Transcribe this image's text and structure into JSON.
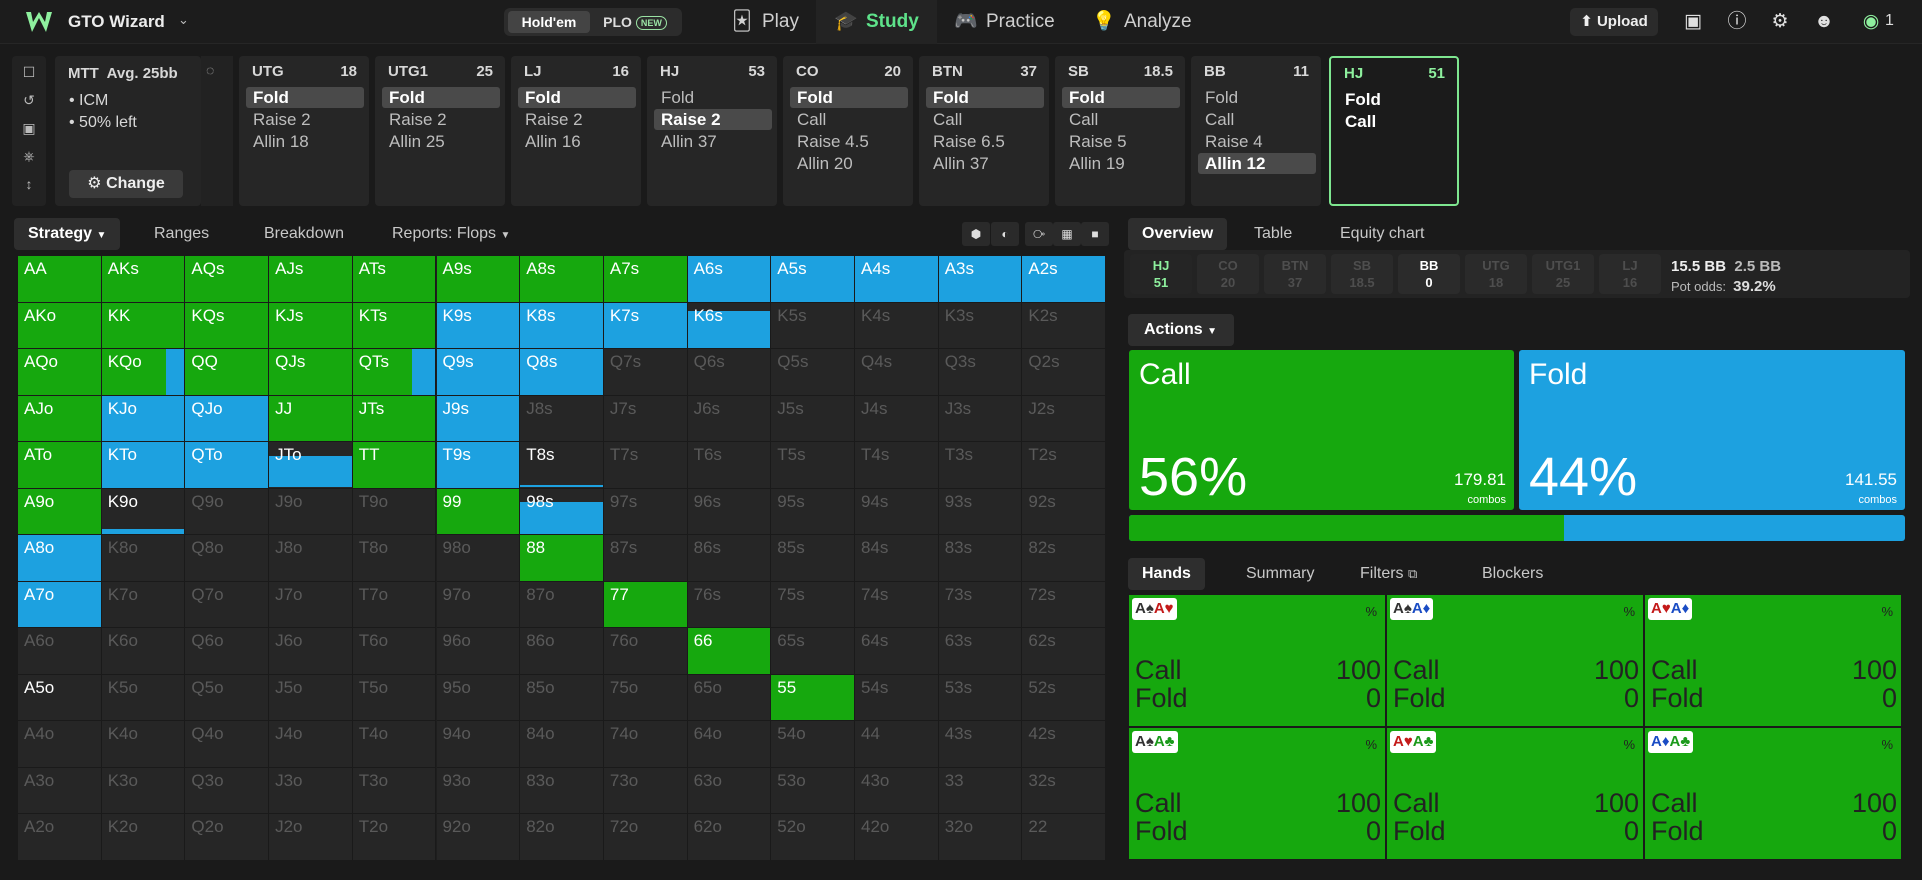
{
  "app": {
    "brand": "GTO Wizard",
    "game_tabs": {
      "holdem": "Hold'em",
      "plo": "PLO",
      "plo_badge": "NEW"
    },
    "nav": {
      "play": "Play",
      "study": "Study",
      "practice": "Practice",
      "analyze": "Analyze"
    },
    "upload": "Upload",
    "coins": "1"
  },
  "info": {
    "title": "MTT  Avg. 25bb",
    "items": [
      "ICM",
      "50% left"
    ],
    "change": "Change"
  },
  "positions": [
    {
      "name": "UTG",
      "stack": "18",
      "actions": [
        "Fold",
        "Raise 2",
        "Allin 18"
      ],
      "selected": 0
    },
    {
      "name": "UTG1",
      "stack": "25",
      "actions": [
        "Fold",
        "Raise 2",
        "Allin 25"
      ],
      "selected": 0
    },
    {
      "name": "LJ",
      "stack": "16",
      "actions": [
        "Fold",
        "Raise 2",
        "Allin 16"
      ],
      "selected": 0
    },
    {
      "name": "HJ",
      "stack": "53",
      "actions": [
        "Fold",
        "Raise 2",
        "Allin 37"
      ],
      "selected": 1
    },
    {
      "name": "CO",
      "stack": "20",
      "actions": [
        "Fold",
        "Call",
        "Raise 4.5",
        "Allin 20"
      ],
      "selected": 0
    },
    {
      "name": "BTN",
      "stack": "37",
      "actions": [
        "Fold",
        "Call",
        "Raise 6.5",
        "Allin 37"
      ],
      "selected": 0
    },
    {
      "name": "SB",
      "stack": "18.5",
      "actions": [
        "Fold",
        "Call",
        "Raise 5",
        "Allin 19"
      ],
      "selected": 0
    },
    {
      "name": "BB",
      "stack": "11",
      "actions": [
        "Fold",
        "Call",
        "Raise 4",
        "Allin 12"
      ],
      "selected": 3
    },
    {
      "name": "HJ",
      "stack": "51",
      "actions": [
        "Fold",
        "Call"
      ],
      "selected": -1,
      "active": true
    }
  ],
  "left_tabs": {
    "strategy": "Strategy",
    "ranges": "Ranges",
    "breakdown": "Breakdown",
    "reports": "Reports: Flops"
  },
  "grid": {
    "labels": [
      [
        "AA",
        "AKs",
        "AQs",
        "AJs",
        "ATs",
        "A9s",
        "A8s",
        "A7s",
        "A6s",
        "A5s",
        "A4s",
        "A3s",
        "A2s"
      ],
      [
        "AKo",
        "KK",
        "KQs",
        "KJs",
        "KTs",
        "K9s",
        "K8s",
        "K7s",
        "K6s",
        "K5s",
        "K4s",
        "K3s",
        "K2s"
      ],
      [
        "AQo",
        "KQo",
        "QQ",
        "QJs",
        "QTs",
        "Q9s",
        "Q8s",
        "Q7s",
        "Q6s",
        "Q5s",
        "Q4s",
        "Q3s",
        "Q2s"
      ],
      [
        "AJo",
        "KJo",
        "QJo",
        "JJ",
        "JTs",
        "J9s",
        "J8s",
        "J7s",
        "J6s",
        "J5s",
        "J4s",
        "J3s",
        "J2s"
      ],
      [
        "ATo",
        "KTo",
        "QTo",
        "JTo",
        "TT",
        "T9s",
        "T8s",
        "T7s",
        "T6s",
        "T5s",
        "T4s",
        "T3s",
        "T2s"
      ],
      [
        "A9o",
        "K9o",
        "Q9o",
        "J9o",
        "T9o",
        "99",
        "98s",
        "97s",
        "96s",
        "95s",
        "94s",
        "93s",
        "92s"
      ],
      [
        "A8o",
        "K8o",
        "Q8o",
        "J8o",
        "T8o",
        "98o",
        "88",
        "87s",
        "86s",
        "85s",
        "84s",
        "83s",
        "82s"
      ],
      [
        "A7o",
        "K7o",
        "Q7o",
        "J7o",
        "T7o",
        "97o",
        "87o",
        "77",
        "76s",
        "75s",
        "74s",
        "73s",
        "72s"
      ],
      [
        "A6o",
        "K6o",
        "Q6o",
        "J6o",
        "T6o",
        "96o",
        "86o",
        "76o",
        "66",
        "65s",
        "64s",
        "63s",
        "62s"
      ],
      [
        "A5o",
        "K5o",
        "Q5o",
        "J5o",
        "T5o",
        "95o",
        "85o",
        "75o",
        "65o",
        "55",
        "54s",
        "53s",
        "52s"
      ],
      [
        "A4o",
        "K4o",
        "Q4o",
        "J4o",
        "T4o",
        "94o",
        "84o",
        "74o",
        "64o",
        "54o",
        "44",
        "43s",
        "42s"
      ],
      [
        "A3o",
        "K3o",
        "Q3o",
        "J3o",
        "T3o",
        "93o",
        "83o",
        "73o",
        "63o",
        "53o",
        "43o",
        "33",
        "32s"
      ],
      [
        "A2o",
        "K2o",
        "Q2o",
        "J2o",
        "T2o",
        "92o",
        "82o",
        "72o",
        "62o",
        "52o",
        "42o",
        "32o",
        "22"
      ]
    ],
    "strategy": {
      "AA": [
        1,
        0,
        1
      ],
      "AKs": [
        1,
        0,
        1
      ],
      "AQs": [
        1,
        0,
        1
      ],
      "AJs": [
        1,
        0,
        1
      ],
      "ATs": [
        1,
        0,
        1
      ],
      "A9s": [
        1,
        0,
        1
      ],
      "A8s": [
        1,
        0,
        1
      ],
      "A7s": [
        1,
        0,
        1
      ],
      "A6s": [
        0,
        1,
        1
      ],
      "A5s": [
        0,
        1,
        1
      ],
      "A4s": [
        0,
        1,
        1
      ],
      "A3s": [
        0,
        1,
        1
      ],
      "A2s": [
        0,
        1,
        1
      ],
      "AKo": [
        1,
        0,
        1
      ],
      "KK": [
        1,
        0,
        1
      ],
      "KQs": [
        1,
        0,
        1
      ],
      "KJs": [
        1,
        0,
        1
      ],
      "KTs": [
        1,
        0,
        1
      ],
      "K9s": [
        0,
        1,
        1
      ],
      "K8s": [
        0,
        1,
        1
      ],
      "K7s": [
        0,
        1,
        1
      ],
      "K6s": [
        0,
        1,
        0.82
      ],
      "AQo": [
        1,
        0,
        1
      ],
      "KQo": [
        0.78,
        0.22,
        1
      ],
      "QQ": [
        1,
        0,
        1
      ],
      "QJs": [
        1,
        0,
        1
      ],
      "QTs": [
        0.72,
        0.28,
        1
      ],
      "Q9s": [
        0,
        1,
        1
      ],
      "Q8s": [
        0,
        1,
        1
      ],
      "AJo": [
        1,
        0,
        1
      ],
      "KJo": [
        0,
        1,
        1
      ],
      "QJo": [
        0,
        1,
        1
      ],
      "JJ": [
        1,
        0,
        1
      ],
      "JTs": [
        1,
        0,
        1
      ],
      "J9s": [
        0,
        1,
        1
      ],
      "ATo": [
        1,
        0,
        1
      ],
      "KTo": [
        0,
        1,
        1
      ],
      "QTo": [
        0,
        1,
        1
      ],
      "JTo": [
        0,
        1,
        0.7
      ],
      "TT": [
        1,
        0,
        1
      ],
      "T9s": [
        0,
        1,
        1
      ],
      "T8s": [
        0,
        1,
        0.06
      ],
      "A9o": [
        1,
        0,
        1
      ],
      "K9o": [
        0,
        1,
        0.12
      ],
      "99": [
        1,
        0,
        1
      ],
      "98s": [
        0,
        1,
        0.7
      ],
      "A8o": [
        0,
        1,
        1
      ],
      "88": [
        1,
        0,
        1
      ],
      "A7o": [
        0,
        1,
        1
      ],
      "77": [
        1,
        0,
        1
      ],
      "66": [
        1,
        0,
        1
      ],
      "A5o": [
        0,
        0,
        0
      ],
      "55": [
        1,
        0,
        1
      ]
    },
    "played": [
      "AA",
      "AKs",
      "AQs",
      "AJs",
      "ATs",
      "A9s",
      "A8s",
      "A7s",
      "A6s",
      "A5s",
      "A4s",
      "A3s",
      "A2s",
      "AKo",
      "KK",
      "KQs",
      "KJs",
      "KTs",
      "K9s",
      "K8s",
      "K7s",
      "K6s",
      "AQo",
      "KQo",
      "QQ",
      "QJs",
      "QTs",
      "Q9s",
      "Q8s",
      "AJo",
      "KJo",
      "QJo",
      "JJ",
      "JTs",
      "J9s",
      "ATo",
      "KTo",
      "QTo",
      "JTo",
      "TT",
      "T9s",
      "T8s",
      "A9o",
      "K9o",
      "99",
      "98s",
      "A8o",
      "88",
      "A7o",
      "77",
      "66",
      "A5o",
      "55"
    ]
  },
  "colors": {
    "call": "#16a80e",
    "fold": "#1da1e0",
    "empty": "#262626"
  },
  "right_tabs": {
    "overview": "Overview",
    "table": "Table",
    "equity": "Equity chart"
  },
  "seats": [
    {
      "name": "HJ",
      "stack": "51",
      "state": "hero"
    },
    {
      "name": "CO",
      "stack": "20",
      "state": "dim"
    },
    {
      "name": "BTN",
      "stack": "37",
      "state": "dim"
    },
    {
      "name": "SB",
      "stack": "18.5",
      "state": "dim"
    },
    {
      "name": "BB",
      "stack": "0",
      "state": "bb"
    },
    {
      "name": "UTG",
      "stack": "18",
      "state": "dim"
    },
    {
      "name": "UTG1",
      "stack": "25",
      "state": "dim"
    },
    {
      "name": "LJ",
      "stack": "16",
      "state": "dim"
    }
  ],
  "pot": {
    "total": "15.5 BB",
    "bet": "2.5 BB",
    "odds_label": "Pot odds:",
    "odds": "39.2%"
  },
  "actions_tab": "Actions",
  "actions": [
    {
      "name": "Call",
      "pct": "56%",
      "pct_value": 56,
      "combos": "179.81",
      "combos_label": "combos"
    },
    {
      "name": "Fold",
      "pct": "44%",
      "pct_value": 44,
      "combos": "141.55",
      "combos_label": "combos"
    }
  ],
  "hand_tabs": {
    "hands": "Hands",
    "summary": "Summary",
    "filters": "Filters",
    "blockers": "Blockers"
  },
  "combos": [
    {
      "cards": [
        [
          "A",
          "s"
        ],
        [
          "A",
          "h"
        ]
      ],
      "call": "100",
      "fold": "0"
    },
    {
      "cards": [
        [
          "A",
          "s"
        ],
        [
          "A",
          "d"
        ]
      ],
      "call": "100",
      "fold": "0"
    },
    {
      "cards": [
        [
          "A",
          "h"
        ],
        [
          "A",
          "d"
        ]
      ],
      "call": "100",
      "fold": "0"
    },
    {
      "cards": [
        [
          "A",
          "s"
        ],
        [
          "A",
          "c"
        ]
      ],
      "call": "100",
      "fold": "0"
    },
    {
      "cards": [
        [
          "A",
          "h"
        ],
        [
          "A",
          "c"
        ]
      ],
      "call": "100",
      "fold": "0"
    },
    {
      "cards": [
        [
          "A",
          "d"
        ],
        [
          "A",
          "c"
        ]
      ],
      "call": "100",
      "fold": "0"
    }
  ],
  "combo_labels": {
    "call": "Call",
    "fold": "Fold",
    "pct": "%"
  }
}
